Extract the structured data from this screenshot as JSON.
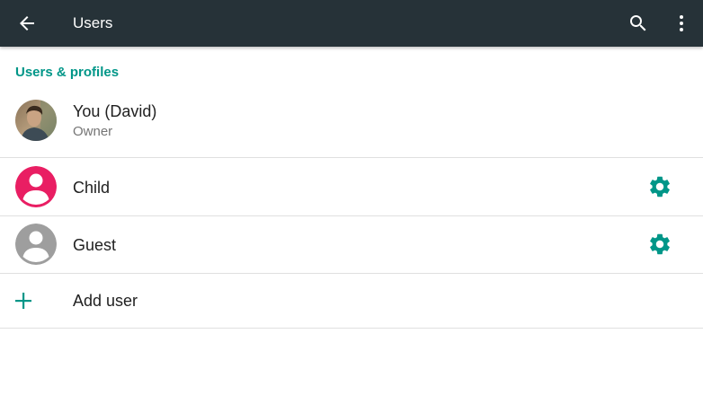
{
  "appbar": {
    "title": "Users",
    "back_icon": "arrow-back-icon",
    "search_icon": "search-icon",
    "overflow_icon": "more-vert-icon",
    "background": "#263238"
  },
  "section": {
    "header": "Users & profiles",
    "accent": "#009688"
  },
  "users": [
    {
      "name": "You (David)",
      "subtitle": "Owner",
      "avatar": "photo",
      "has_settings": false
    },
    {
      "name": "Child",
      "avatar": "person-icon",
      "avatar_color": "#E91E63",
      "has_settings": true,
      "settings_icon": "gear-icon"
    },
    {
      "name": "Guest",
      "avatar": "person-icon",
      "avatar_color": "#9E9E9E",
      "has_settings": true,
      "settings_icon": "gear-icon"
    }
  ],
  "add_user": {
    "label": "Add user",
    "icon": "plus-icon"
  }
}
